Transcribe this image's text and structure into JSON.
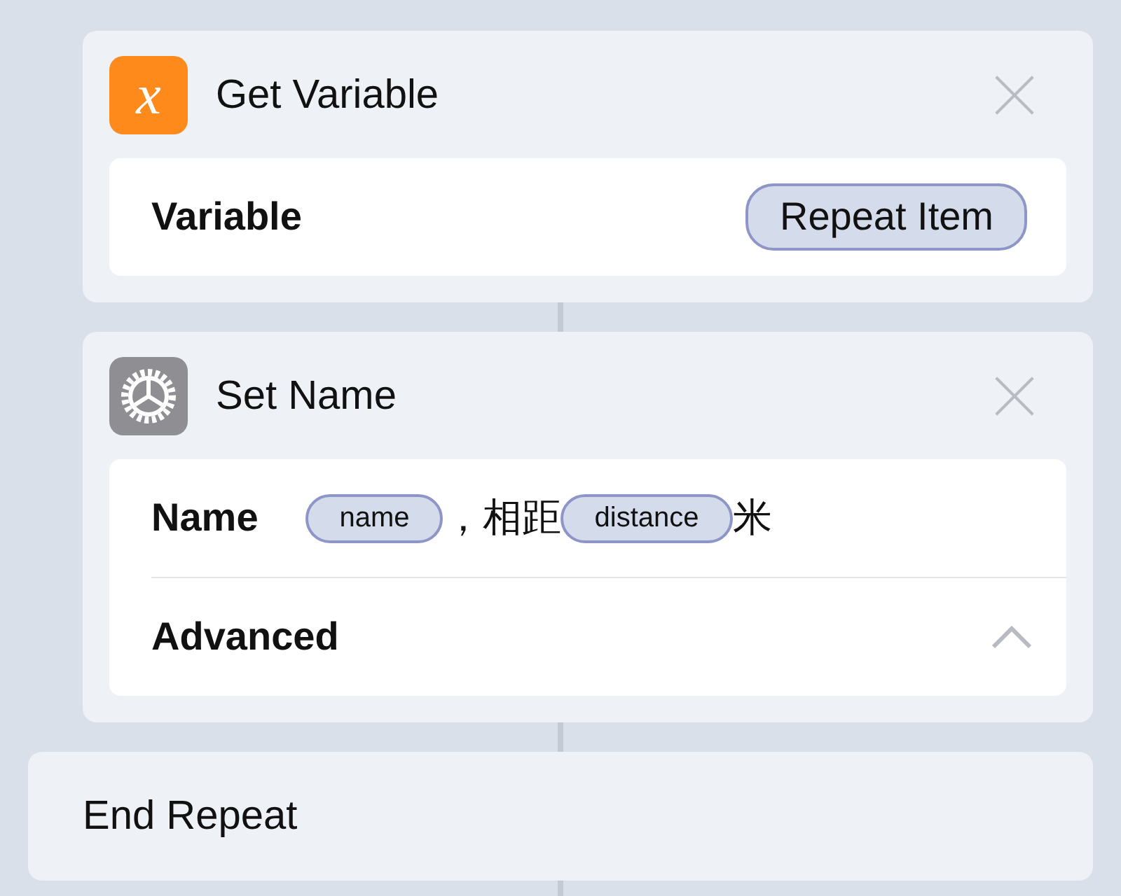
{
  "actions": [
    {
      "kind": "variable",
      "icon_glyph": "x",
      "title": "Get Variable",
      "params": [
        {
          "kind": "value",
          "label": "Variable",
          "parts": [
            {
              "kind": "token",
              "text": "Repeat Item"
            }
          ]
        }
      ]
    },
    {
      "kind": "settings",
      "title": "Set Name",
      "params": [
        {
          "kind": "value",
          "label": "Name",
          "parts": [
            {
              "kind": "token",
              "text": "name"
            },
            {
              "kind": "text",
              "text": "，相距"
            },
            {
              "kind": "token",
              "text": "distance"
            },
            {
              "kind": "text",
              "text": "米"
            }
          ]
        },
        {
          "kind": "disclosure",
          "label": "Advanced",
          "expanded": true
        }
      ]
    }
  ],
  "end_block": {
    "title": "End Repeat"
  }
}
